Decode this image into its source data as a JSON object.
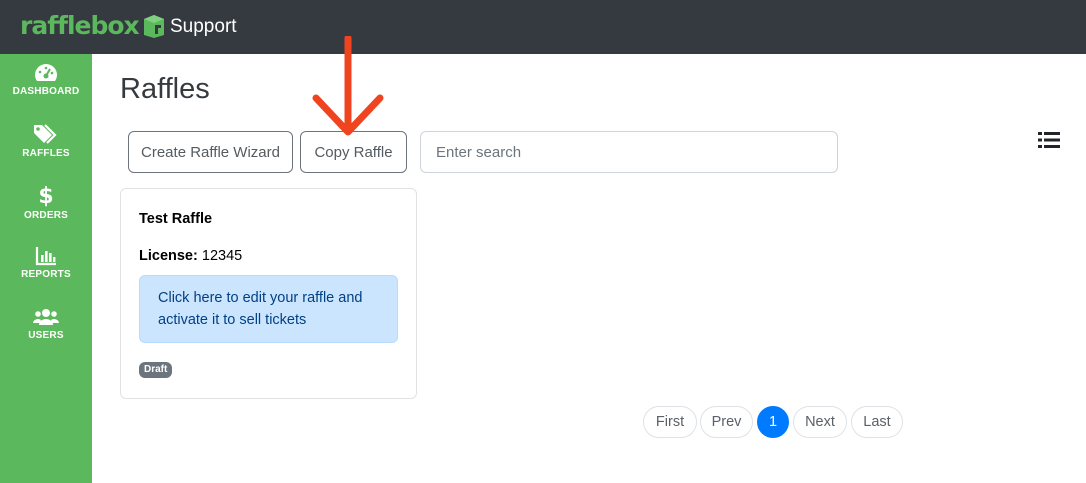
{
  "header": {
    "logo_text": "rafflebox",
    "section_title": "Support",
    "brand_color": "#5cb85c",
    "bar_color": "#343a40"
  },
  "sidebar": {
    "items": [
      {
        "label": "DASHBOARD",
        "icon": "dashboard-icon"
      },
      {
        "label": "RAFFLES",
        "icon": "tags-icon"
      },
      {
        "label": "ORDERS",
        "icon": "dollar-icon"
      },
      {
        "label": "REPORTS",
        "icon": "bar-chart-icon"
      },
      {
        "label": "USERS",
        "icon": "users-icon"
      }
    ]
  },
  "main": {
    "title": "Raffles",
    "toolbar": {
      "wizard_label": "Create Raffle Wizard",
      "copy_label": "Copy Raffle",
      "search_placeholder": "Enter search",
      "list_icon": "list-icon"
    },
    "annotation_arrow_color": "#f0431f",
    "cards": [
      {
        "title": "Test Raffle",
        "license_label": "License:",
        "license_value": "12345",
        "alert_text": "Click here to edit your raffle and activate it to sell tickets",
        "status_badge": "Draft"
      }
    ],
    "pagination": {
      "first": "First",
      "prev": "Prev",
      "current": "1",
      "next": "Next",
      "last": "Last",
      "active_color": "#007bff"
    }
  }
}
